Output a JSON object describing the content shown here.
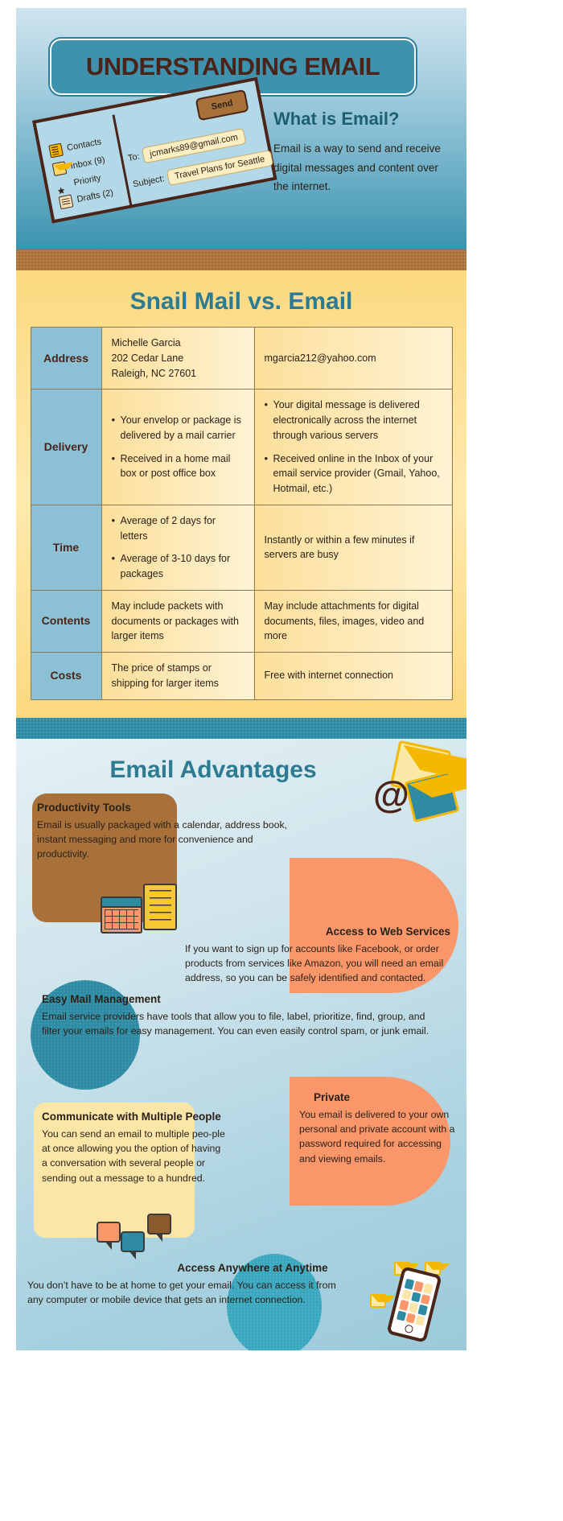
{
  "header": {
    "title": "UNDERSTANDING EMAIL",
    "what_is_heading": "What is Email?",
    "what_is_body": "Email is a way to send and receive digital messages and content over the internet."
  },
  "mail_client": {
    "send_button": "Send",
    "nav": [
      {
        "icon": "contacts-icon",
        "label": "Contacts"
      },
      {
        "icon": "inbox-envelope-icon",
        "label": "Inbox (9)"
      },
      {
        "icon": "star-icon",
        "label": "Priority"
      },
      {
        "icon": "drafts-icon",
        "label": "Drafts (2)"
      }
    ],
    "to_label": "To:",
    "to_value": "jcmarks89@gmail.com",
    "subject_label": "Subject:",
    "subject_value": "Travel Plans for Seattle"
  },
  "comparison": {
    "heading": "Snail Mail vs. Email",
    "rows": [
      {
        "category": "Address",
        "snail": [
          "Michelle Garcia",
          "202 Cedar Lane",
          "Raleigh, NC 27601"
        ],
        "snail_type": "lines",
        "email": [
          "mgarcia212@yahoo.com"
        ],
        "email_type": "lines"
      },
      {
        "category": "Delivery",
        "snail": [
          "Your envelop or package is delivered by a mail carrier",
          "Received in a home mail box or post office box"
        ],
        "snail_type": "bullets",
        "email": [
          "Your digital message is delivered electronically across the internet through various servers",
          "Received online in the Inbox of your email service provider (Gmail, Yahoo, Hotmail, etc.)"
        ],
        "email_type": "bullets"
      },
      {
        "category": "Time",
        "snail": [
          "Average of 2 days for letters",
          "Average of 3-10 days for packages"
        ],
        "snail_type": "bullets",
        "email": [
          "Instantly or within a few minutes if servers are busy"
        ],
        "email_type": "lines"
      },
      {
        "category": "Contents",
        "snail": [
          "May include packets with documents or packages with larger items"
        ],
        "snail_type": "lines",
        "email": [
          "May include attachments for digital documents, files, images, video and more"
        ],
        "email_type": "lines"
      },
      {
        "category": "Costs",
        "snail": [
          "The price of stamps or shipping for larger items"
        ],
        "snail_type": "lines",
        "email": [
          "Free  with internet connection"
        ],
        "email_type": "lines"
      }
    ]
  },
  "advantages": {
    "heading": "Email Advantages",
    "items": [
      {
        "title": "Productivity Tools",
        "body": "Email is usually packaged with a calendar, address book, instant messaging and more for convenience and productivity."
      },
      {
        "title": "Access to Web Services",
        "body": "If you want to sign up for accounts like Facebook, or order products from services like Amazon, you will need an email address, so you can be safely identified and contacted."
      },
      {
        "title": "Easy Mail Management",
        "body": "Email service providers have tools that allow you to file, label, prioritize, find, group, and filter your emails for easy management. You can even easily control spam, or junk email."
      },
      {
        "title": "Communicate with Multiple People",
        "body": "You can send an email to multiple peo-ple at once allowing you the option of having a conversation with several people or sending out a message to a hundred."
      },
      {
        "title": "Private",
        "body": "You email is delivered to your own personal and private account with a password required for accessing and viewing emails."
      },
      {
        "title": "Access Anywhere at Anytime",
        "body": "You don’t have to be at home to get your email. You can access it from any computer or mobile device that gets an internet connection."
      }
    ]
  },
  "colors": {
    "teal": "#2f8ba3",
    "brown": "#a8713a",
    "orange": "#f9976a",
    "yellow": "#fbe6a8",
    "heading_teal": "#2c7b93",
    "dark_brown_text": "#4a2418",
    "table_category_blue": "#8cc0d4"
  }
}
